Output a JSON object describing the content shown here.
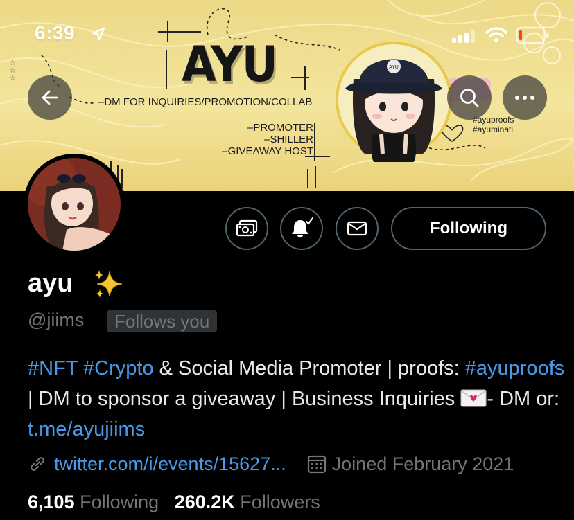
{
  "status_bar": {
    "time": "6:39"
  },
  "banner": {
    "title": "AYU",
    "dm_line": "–DM FOR INQUIRIES/PROMOTION/COLLAB",
    "roles": [
      "–PROMOTER",
      "–SHILLER",
      "–GIVEAWAY HOST"
    ],
    "hashtags": [
      "#ayuproofs",
      "#ayuminati"
    ],
    "hat_logo": "AYU"
  },
  "profile": {
    "display_name": "ayu",
    "name_emoji": "✨",
    "handle": "@jiims",
    "follows_you": "Follows you",
    "following_button": "Following",
    "bio": {
      "tag1": "#NFT",
      "tag2": "#Crypto",
      "text1": " & Social Media Promoter | proofs: ",
      "tag3": "#ayuproofs",
      "text2": " | DM to sponsor a giveaway | Business Inquiries ",
      "text3": "- DM or: ",
      "link": "t.me/ayujiims"
    },
    "website": "twitter.com/i/events/15627...",
    "joined": "Joined February 2021",
    "following_count": "6,105",
    "following_label": "Following",
    "followers_count": "260.2K",
    "followers_label": "Followers"
  },
  "icons": [
    "location-arrow-icon",
    "signal-icon",
    "wifi-icon",
    "battery-icon",
    "back-arrow-icon",
    "search-icon",
    "more-icon",
    "tip-jar-icon",
    "notification-bell-icon",
    "envelope-icon",
    "link-icon",
    "calendar-icon",
    "sparkles-icon",
    "love-letter-icon"
  ],
  "colors": {
    "accent": "#4a99e9",
    "muted": "#71767b",
    "border": "#536471",
    "banner": "#f0df93",
    "battery_low": "#ff3b30"
  }
}
